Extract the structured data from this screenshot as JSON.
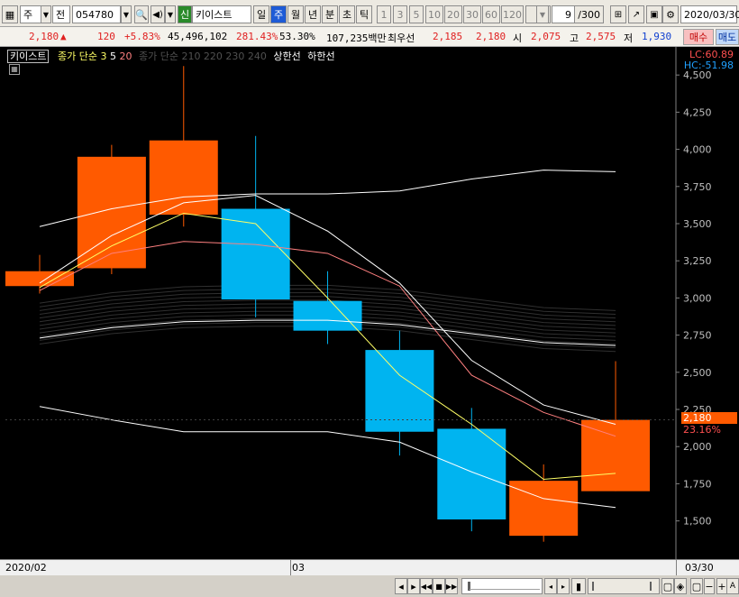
{
  "toolbar": {
    "market_type": "주",
    "prefix": "전",
    "stock_code": "054780",
    "badge": "신",
    "stock_name": "키이스트",
    "periods": [
      "일",
      "주",
      "월",
      "년",
      "분",
      "초",
      "틱"
    ],
    "active_period": "주",
    "intervals": [
      "1",
      "3",
      "5",
      "10",
      "20",
      "30",
      "60",
      "120"
    ],
    "count": "9",
    "count_total": "/300",
    "date": "2020/03/30"
  },
  "quote": {
    "price": "2,180",
    "change_arrow": "▲",
    "change": "120",
    "change_pct": "+5.83%",
    "volume": "45,496,102",
    "volume_ratio": "281.43%",
    "turnover": "53.30%",
    "amount": "107,235백만",
    "best_label": "최우선",
    "best_ask": "2,185",
    "best_bid": "2,180",
    "open_label": "시",
    "open": "2,075",
    "high_label": "고",
    "high": "2,575",
    "low_label": "저",
    "low": "1,930",
    "sell_label": "매수",
    "buy_label": "매도"
  },
  "legend": {
    "name": "키이스트",
    "ma_label": "종가 단순",
    "ma_periods": [
      "3",
      "5",
      "20"
    ],
    "ma_long_label": "종가 단순 210 220 230 240",
    "upper_limit": "상한선",
    "lower_limit": "하한선"
  },
  "indicators": {
    "lc": "LC:60.89",
    "hc": "HC:-51.98"
  },
  "current_price_tag": {
    "price": "2,180",
    "pct": "23.16%"
  },
  "chart_data": {
    "type": "candlestick",
    "x": [
      "2020/02 wk1",
      "2020/02 wk2",
      "2020/02 wk3",
      "2020/02 wk4",
      "2020/03 wk1",
      "2020/03 wk2",
      "2020/03 wk3",
      "2020/03 wk4",
      "2020/03/30"
    ],
    "open": [
      3080,
      3200,
      3560,
      3600,
      2980,
      2650,
      2120,
      1400,
      1700
    ],
    "close": [
      3180,
      3950,
      4060,
      2990,
      2780,
      2100,
      1510,
      1770,
      2180
    ],
    "high": [
      3290,
      4030,
      4560,
      4090,
      3180,
      2780,
      2260,
      1880,
      2575
    ],
    "low": [
      3030,
      3160,
      3480,
      2870,
      2690,
      1940,
      1430,
      1360,
      1700
    ],
    "up_color": "#ff5a00",
    "down_color": "#00b4f0",
    "series": [
      {
        "name": "3",
        "color": "#ffff66",
        "values": [
          3070,
          3350,
          3570,
          3500,
          3000,
          2480,
          2150,
          1780,
          1820
        ]
      },
      {
        "name": "5",
        "color": "#ffffff",
        "values": [
          3100,
          3420,
          3640,
          3690,
          3450,
          3100,
          2580,
          2280,
          2150
        ]
      },
      {
        "name": "20",
        "color": "#ff8080",
        "values": [
          3050,
          3300,
          3380,
          3360,
          3300,
          3080,
          2480,
          2230,
          2070
        ]
      },
      {
        "name": "upper",
        "color": "#ffffff",
        "values": [
          3480,
          3600,
          3680,
          3700,
          3700,
          3720,
          3800,
          3860,
          3850
        ]
      },
      {
        "name": "mid",
        "color": "#ffffff",
        "values": [
          2730,
          2800,
          2840,
          2850,
          2850,
          2820,
          2760,
          2700,
          2680
        ]
      },
      {
        "name": "lower",
        "color": "#ffffff",
        "values": [
          2270,
          2180,
          2100,
          2100,
          2100,
          2030,
          1830,
          1650,
          1590
        ]
      }
    ],
    "y_ticks": [
      "4,500",
      "4,250",
      "4,000",
      "3,750",
      "3,500",
      "3,250",
      "3,000",
      "2,750",
      "2,500",
      "2,250",
      "2,000",
      "1,750",
      "1,500"
    ],
    "ylim": [
      1340,
      4580
    ],
    "x_labels": [
      "2020/02",
      "03",
      "03/30"
    ]
  }
}
